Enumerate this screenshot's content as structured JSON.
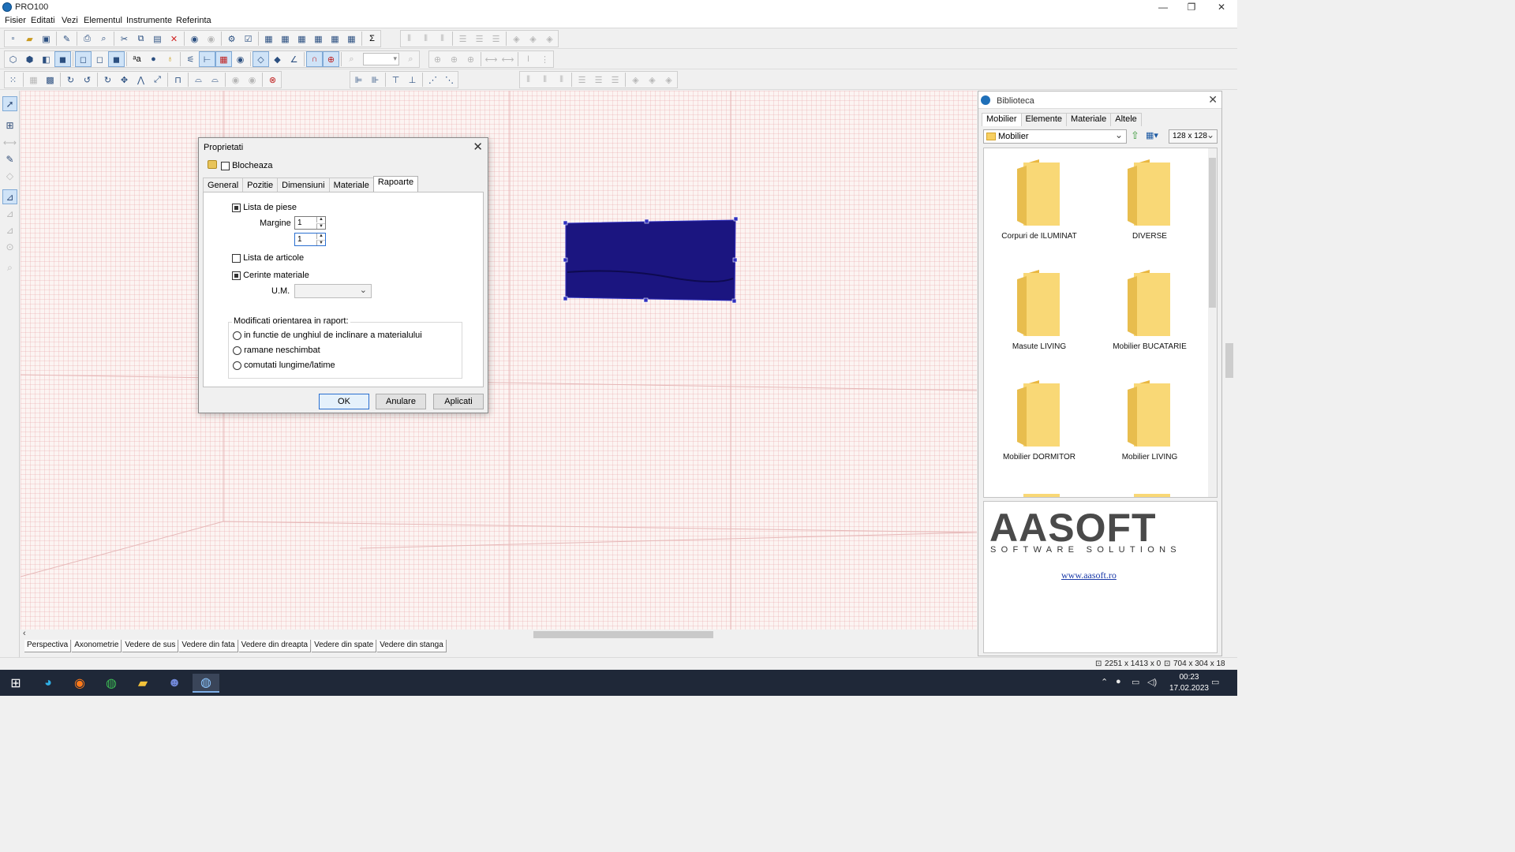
{
  "window": {
    "title": "PRO100"
  },
  "menu": [
    "Fisier",
    "Editati",
    "Vezi",
    "Elementul",
    "Instrumente",
    "Referinta"
  ],
  "toolbars": {
    "row1_icons": [
      "new-icon",
      "open-icon",
      "save-icon",
      "save-as-icon",
      "print-icon",
      "print-preview-icon",
      "cut-icon",
      "copy-icon",
      "paste-icon",
      "delete-icon",
      "undo-icon",
      "redo-icon",
      "settings-icon",
      "properties-icon",
      "view1-icon",
      "view2-icon",
      "view3-icon",
      "view4-icon",
      "view5-icon",
      "view6-icon",
      "sum-icon"
    ],
    "row2_icons": [
      "cube-icon",
      "box-icon",
      "shade-icon",
      "solid-icon",
      "frame-icon",
      "wire-icon",
      "texture-icon",
      "text-icon",
      "light-icon",
      "bulb-icon",
      "grid-icon",
      "ruler-icon",
      "hatch-icon",
      "eye-icon",
      "snap1-icon",
      "snap2-icon",
      "angle-icon",
      "magnet-icon",
      "target-icon",
      "zoom-in-icon",
      "zoom-out-icon"
    ],
    "row3_icons": [
      "select-all-icon",
      "group-icon",
      "ungroup-icon",
      "rotate-left-icon",
      "rotate-right-icon",
      "refresh-icon",
      "move-icon",
      "mirror-icon",
      "scale-icon",
      "align-icon",
      "bend-icon",
      "bend2-icon",
      "stop-icon"
    ]
  },
  "view_tabs": [
    "Perspectiva",
    "Axonometrie",
    "Vedere de sus",
    "Vedere din fata",
    "Vedere din dreapta",
    "Vedere din spate",
    "Vedere din stanga"
  ],
  "status": {
    "coords": "2251 x 1413 x 0",
    "size": "704 x 304 x 18"
  },
  "dialog": {
    "title": "Proprietati",
    "lock_label": "Blocheaza",
    "tabs": [
      "General",
      "Pozitie",
      "Dimensiuni",
      "Materiale",
      "Rapoarte"
    ],
    "active_tab": "Rapoarte",
    "lista_piese_label": "Lista de piese",
    "margine_label": "Margine",
    "margine_value1": "1",
    "margine_value2": "1",
    "lista_articole_label": "Lista de articole",
    "cerinte_label": "Cerinte materiale",
    "um_label": "U.M.",
    "um_value": "",
    "group_title": "Modificati orientarea in raport:",
    "radio1": "in functie de unghiul de inclinare a materialului",
    "radio2": "ramane neschimbat",
    "radio3": "comutati lungime/latime",
    "ok": "OK",
    "cancel": "Anulare",
    "apply": "Aplicati"
  },
  "library": {
    "title": "Biblioteca",
    "tabs": [
      "Mobilier",
      "Elemente",
      "Materiale",
      "Altele"
    ],
    "path": "Mobilier",
    "thumb_size": "128 x 128",
    "folders": [
      "Corpuri de ILUMINAT",
      "DIVERSE",
      "Masute LIVING",
      "Mobilier BUCATARIE",
      "Mobilier DORMITOR",
      "Mobilier LIVING"
    ],
    "logo_text": "AASOFT",
    "logo_sub": "SOFTWARE SOLUTIONS",
    "link": "www.aasoft.ro"
  },
  "taskbar": {
    "time": "00:23",
    "date": "17.02.2023"
  },
  "colors": {
    "panel_fill": "#1b1580",
    "selection_handle": "#3030c0",
    "accent": "#2a6fd0"
  }
}
